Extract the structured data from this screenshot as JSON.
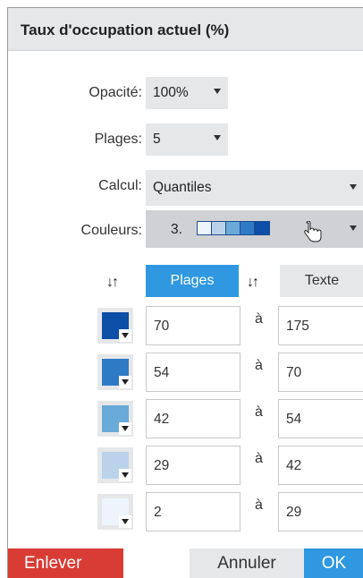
{
  "header": {
    "title": "Taux d'occupation actuel (%)"
  },
  "form": {
    "opacity": {
      "label": "Opacité:",
      "value": "100%"
    },
    "ranges": {
      "label": "Plages:",
      "value": "5"
    },
    "calc": {
      "label": "Calcul:",
      "value": "Quantiles"
    },
    "colors": {
      "label": "Couleurs:",
      "value": "3.",
      "ramp": [
        "#eef4fc",
        "#bad3eb",
        "#6aaad9",
        "#2f7ac4",
        "#0d4ea6"
      ]
    }
  },
  "sort": {
    "icon": "sort-icon",
    "tab_ranges": "Plages",
    "tab_text": "Texte"
  },
  "rows": [
    {
      "color": "#0d4ea6",
      "from": "70",
      "sep": "à",
      "to": "175"
    },
    {
      "color": "#2f7ac4",
      "from": "54",
      "sep": "à",
      "to": "70"
    },
    {
      "color": "#6aaad9",
      "from": "42",
      "sep": "à",
      "to": "54"
    },
    {
      "color": "#bad3eb",
      "from": "29",
      "sep": "à",
      "to": "42"
    },
    {
      "color": "#eef4fc",
      "from": "2",
      "sep": "à",
      "to": "29"
    }
  ],
  "footer": {
    "remove": "Enlever",
    "cancel": "Annuler",
    "ok": "OK"
  },
  "colors": {
    "accent": "#2f98e0",
    "danger": "#d93c35",
    "neutral": "#e6e7e9"
  }
}
